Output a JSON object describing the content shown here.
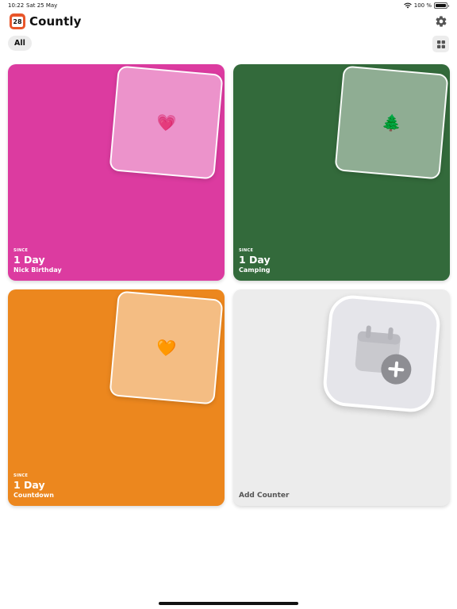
{
  "status_bar": {
    "time": "10:22",
    "date": "Sat 25 May",
    "battery": "100 %",
    "battery_level": 1.0
  },
  "app": {
    "title": "Countly",
    "icon_number": "28"
  },
  "filter": {
    "label": "All"
  },
  "counters": [
    {
      "emoji": "💗",
      "since_label": "SINCE",
      "count": "1 Day",
      "name": "Nick Birthday",
      "color": "#dc3ba0"
    },
    {
      "emoji": "🌲",
      "since_label": "SINCE",
      "count": "1 Day",
      "name": "Camping",
      "color": "#336a3b"
    },
    {
      "emoji": "🧡",
      "since_label": "SINCE",
      "count": "1 Day",
      "name": "Countdown",
      "color": "#ec871e"
    }
  ],
  "add_card": {
    "label": "Add Counter",
    "icon": "calendar-plus-icon"
  },
  "icons": {
    "settings": "gear-icon",
    "layout": "grid-icon",
    "wifi": "wifi-icon",
    "battery": "battery-icon"
  }
}
